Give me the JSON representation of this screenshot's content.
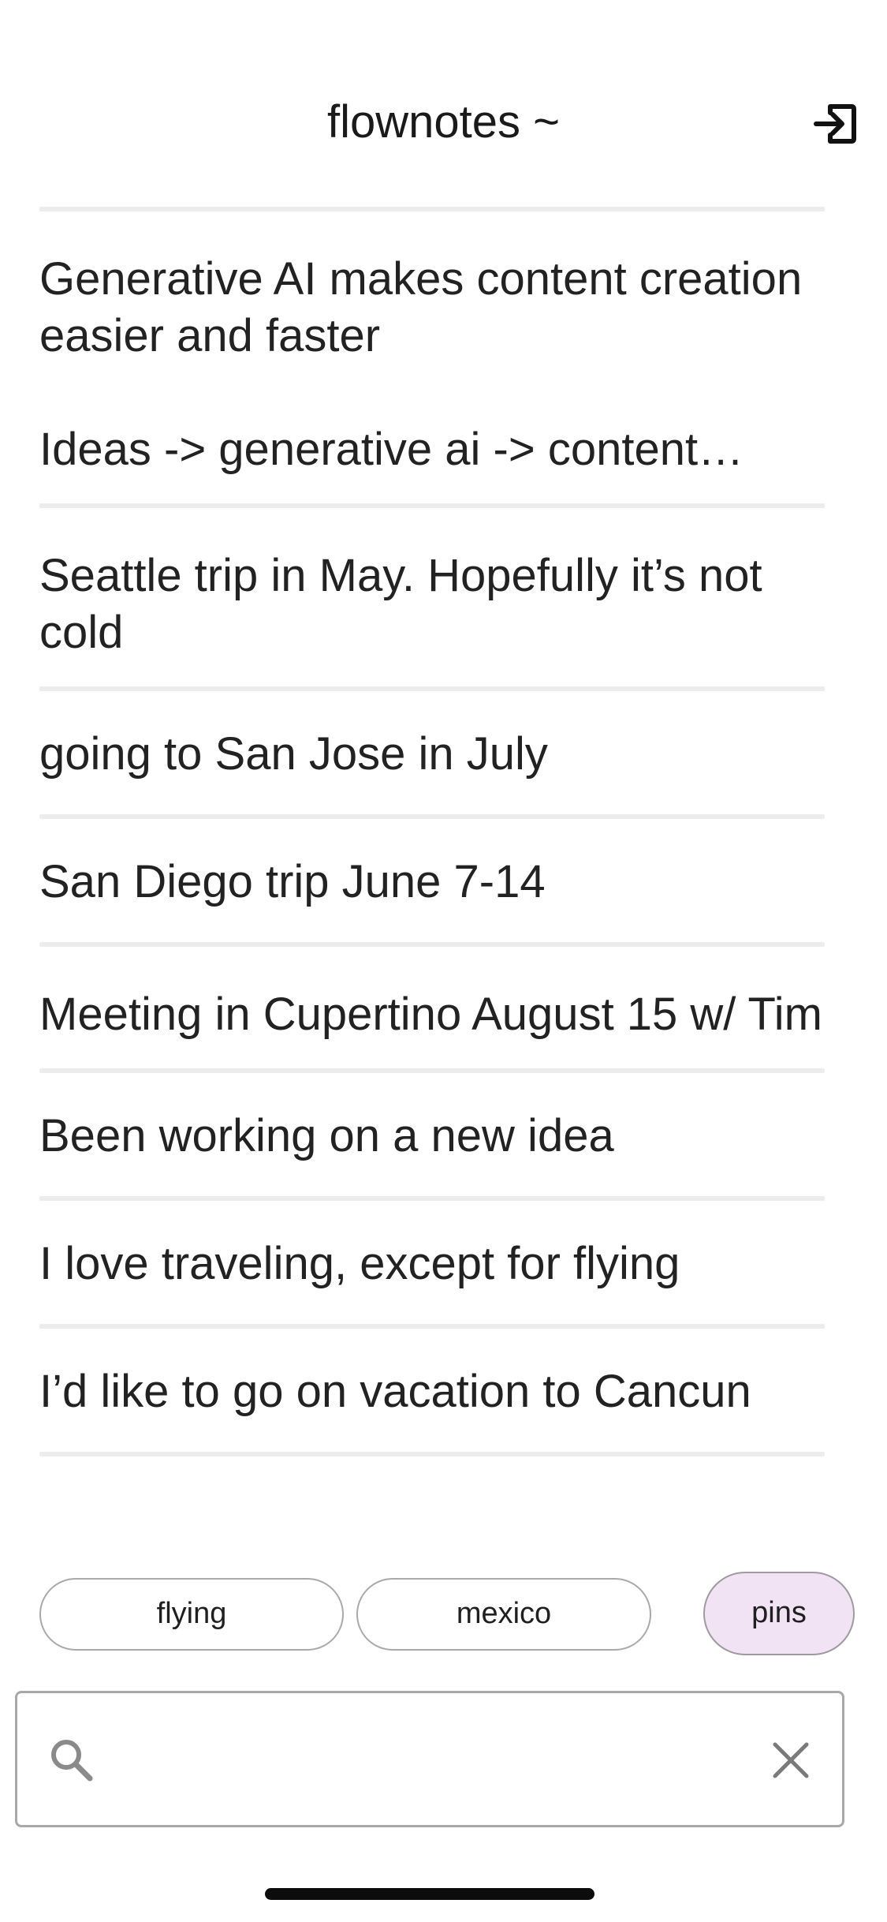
{
  "header": {
    "title": "flownotes ~",
    "logout_icon": "logout-icon"
  },
  "notes": [
    {
      "text": "Generative AI makes content creation easier and faster",
      "preview": "Ideas -> generative ai -> content…"
    },
    {
      "text": "Seattle trip in May. Hopefully it’s not cold"
    },
    {
      "text": "going to San Jose in July"
    },
    {
      "text": "San Diego trip June 7-14"
    },
    {
      "text": "Meeting in Cupertino August 15 w/ Tim"
    },
    {
      "text": "Been working on a new idea"
    },
    {
      "text": "I love traveling, except for flying"
    },
    {
      "text": "I’d like to go on vacation to Cancun"
    }
  ],
  "tags": [
    {
      "label": "flying",
      "active": false
    },
    {
      "label": "mexico",
      "active": false
    },
    {
      "label": "pins",
      "active": true
    }
  ],
  "search": {
    "value": "",
    "placeholder": "",
    "search_icon": "search-icon",
    "clear_icon": "close-icon"
  },
  "colors": {
    "active_tag_bg": "#f1e3f4",
    "divider": "#ececec",
    "border": "#a8a8a8"
  }
}
